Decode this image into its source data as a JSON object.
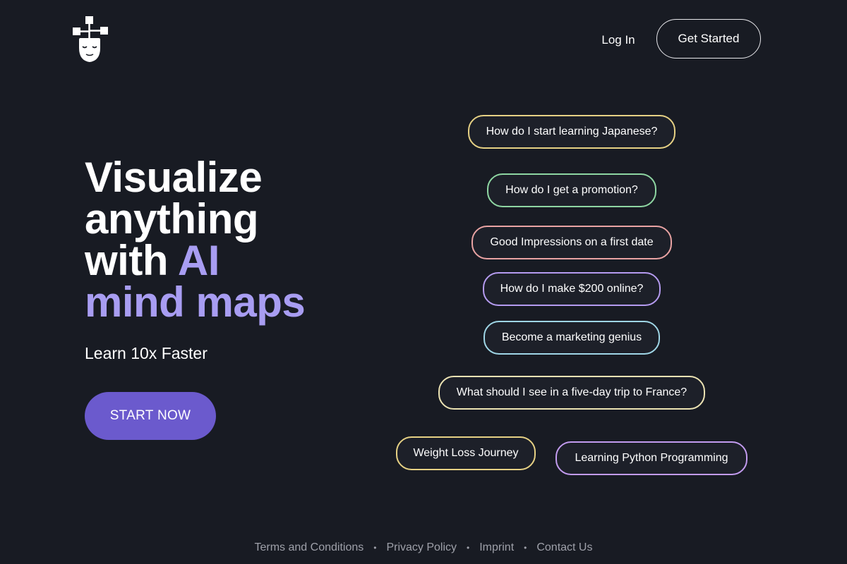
{
  "header": {
    "login_label": "Log In",
    "get_started_label": "Get Started"
  },
  "hero": {
    "title_line1": "Visualize",
    "title_line2": "anything",
    "title_line3_plain": "with ",
    "title_line3_accent": "AI",
    "title_line4": "mind maps",
    "subtitle": "Learn 10x Faster",
    "cta_label": "START NOW"
  },
  "prompts": [
    {
      "label": "How do I start learning Japanese?",
      "color": "#e6d184"
    },
    {
      "label": "How do I get a promotion?",
      "color": "#8ed6a2"
    },
    {
      "label": "Good Impressions on a first date",
      "color": "#e9a3a3"
    },
    {
      "label": "How do I make $200 online?",
      "color": "#b59bf0"
    },
    {
      "label": "Become a marketing genius",
      "color": "#9fd6e6"
    },
    {
      "label": "What should I see in a five-day trip to France?",
      "color": "#ece3b3"
    },
    {
      "label": "Weight Loss Journey",
      "color": "#e6d184"
    },
    {
      "label": "Learning Python Programming",
      "color": "#c29bef"
    }
  ],
  "footer": {
    "links": [
      "Terms and Conditions",
      "Privacy Policy",
      "Imprint",
      "Contact Us"
    ],
    "separator": "•"
  },
  "colors": {
    "background": "#181b23",
    "accent": "#a89df2",
    "button": "#6b5acd",
    "footer_text": "#9ea0a9"
  },
  "icons": {
    "logo": "head-with-mindmap-icon"
  }
}
